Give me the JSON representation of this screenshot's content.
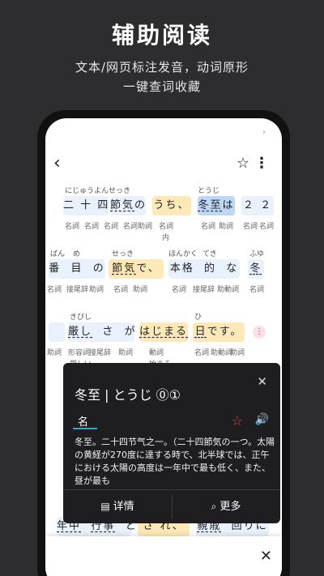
{
  "promo": {
    "title": "辅助阅读",
    "subtitle_line1": "文本/网页标注发音，动词原形",
    "subtitle_line2": "一键查词收藏"
  },
  "toolbar": {
    "back_icon": "‹",
    "star_icon": "☆",
    "more_icon": "⋮"
  },
  "rows": [
    {
      "ruby": [
        "にじゅうよんせっき",
        "とうじ"
      ],
      "tokens": [
        "二",
        "十",
        "四",
        "節気",
        "の",
        "うち、",
        "冬至",
        "は",
        "２",
        "２"
      ],
      "pos": [
        "名詞",
        "名詞",
        "名詞",
        "名詞",
        "助詞",
        "名詞",
        "内",
        "名詞",
        "助詞",
        "名詞",
        "名詞"
      ]
    },
    {
      "ruby": [
        "ばん",
        "め",
        "せっき",
        "ほんかく",
        "てき",
        "ふゆ"
      ],
      "tokens": [
        "番",
        "目",
        "の",
        "節気",
        "で、",
        "本格",
        "的",
        "な",
        "冬"
      ],
      "pos": [
        "名詞",
        "接尾辞",
        "助詞",
        "名詞",
        "助詞",
        "名詞",
        "接尾辞",
        "助動詞",
        "名詞"
      ]
    },
    {
      "ruby": [
        "きびし",
        "ひ"
      ],
      "tokens": [
        "厳し",
        "さ",
        "が",
        "はじまる",
        "日",
        "です。"
      ],
      "pos": [
        "助詞",
        "形容詞",
        "接尾辞",
        "助詞",
        "動詞",
        "名詞",
        "助動詞",
        "助詞"
      ],
      "extra": [
        "厳しい",
        "始まる"
      ],
      "pink": "⋮"
    },
    {
      "tokens": [
        "年中",
        "行事",
        "と",
        "さ",
        "れ、",
        "親戚",
        "回り",
        "に"
      ]
    }
  ],
  "popup": {
    "headword": "冬至 | とうじ ⓪①",
    "pos": "名",
    "definition": "冬至。二十四节气之一。（二十四節気の一つ。太陽の黄経が270度に達する時で、北半球では、正午における太陽の高度は一年中で最も低く、また、昼が最も",
    "detail_label": "详情",
    "more_label": "更多",
    "close_icon": "✕",
    "star_icon": "☆",
    "speaker_icon": "🔊",
    "detail_icon": "▤",
    "more_icon": "⌕",
    "accent": "#e1415a",
    "pos_underline": "#3aa3c9"
  },
  "sheet": {
    "close_icon": "✕"
  }
}
